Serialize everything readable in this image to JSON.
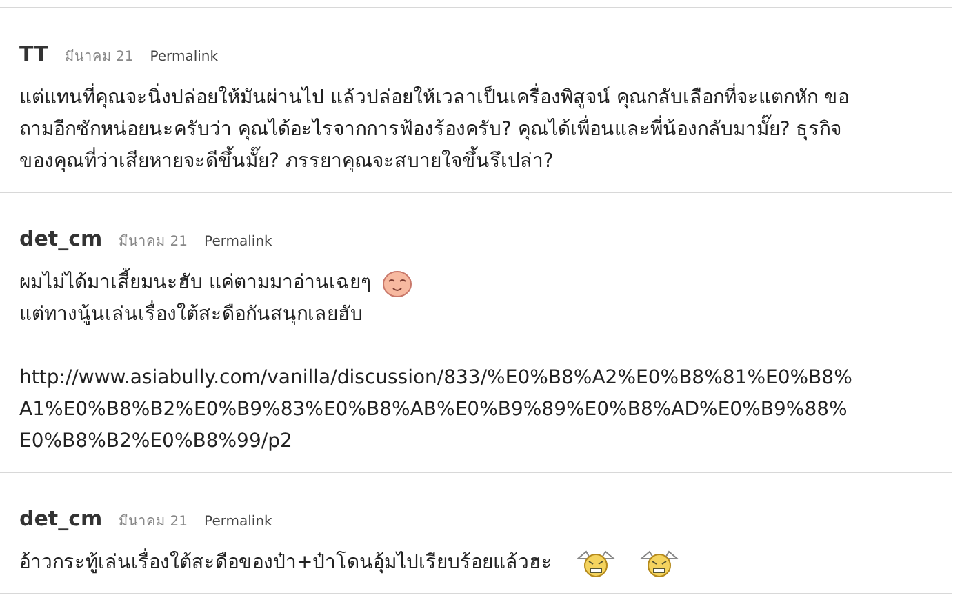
{
  "comments": [
    {
      "author": "TT",
      "date": "มีนาคม 21",
      "permalink": "Permalink",
      "paragraphs": [
        [
          {
            "text": "แต่แทนที่คุณจะนิ่งปล่อยให้มันผ่านไป แล้วปล่อยให้เวลาเป็นเครื่องพิสูจน์ คุณกลับเลือกที่จะแตกหัก ขอ"
          },
          {
            "text": "ถามอีกซักหน่อยนะครับว่า คุณได้อะไรจากการฟ้องร้องครับ? คุณได้เพื่อนและพี่น้องกลับมามั๊ย? ธุรกิจ"
          },
          {
            "text": "ของคุณที่ว่าเสียหายจะดีขึ้นมั๊ย? ภรรยาคุณจะสบายใจขึ้นรึเปล่า?"
          }
        ]
      ]
    },
    {
      "author": "det_cm",
      "date": "มีนาคม 21",
      "permalink": "Permalink",
      "paragraphs": [
        [
          {
            "text": "ผมไม่ได้มาเสี้ยมนะฮับ แค่ตามมาอ่านเฉยๆ",
            "emoticons": [
              {
                "kind": "blush"
              }
            ]
          },
          {
            "text": "แต่ทางนู้นเล่นเรื่องใต้สะดือกันสนุกเลยฮับ"
          }
        ],
        [
          {
            "text": "http://www.asiabully.com/vanilla/discussion/833/%E0%B8%A2%E0%B8%81%E0%B8%"
          },
          {
            "text": "A1%E0%B8%B2%E0%B9%83%E0%B8%AB%E0%B9%89%E0%B8%AD%E0%B9%88%"
          },
          {
            "text": "E0%B8%B2%E0%B8%99/p2"
          }
        ]
      ]
    },
    {
      "author": "det_cm",
      "date": "มีนาคม 21",
      "permalink": "Permalink",
      "paragraphs": [
        [
          {
            "text": "อ้าวกระทู้เล่นเรื่องใต้สะดือของป๋า+ป๋าโดนอุ้มไปเรียบร้อยแล้วฮะ",
            "emoticons": [
              {
                "kind": "angry"
              },
              {
                "kind": "angry"
              }
            ]
          }
        ]
      ]
    }
  ]
}
